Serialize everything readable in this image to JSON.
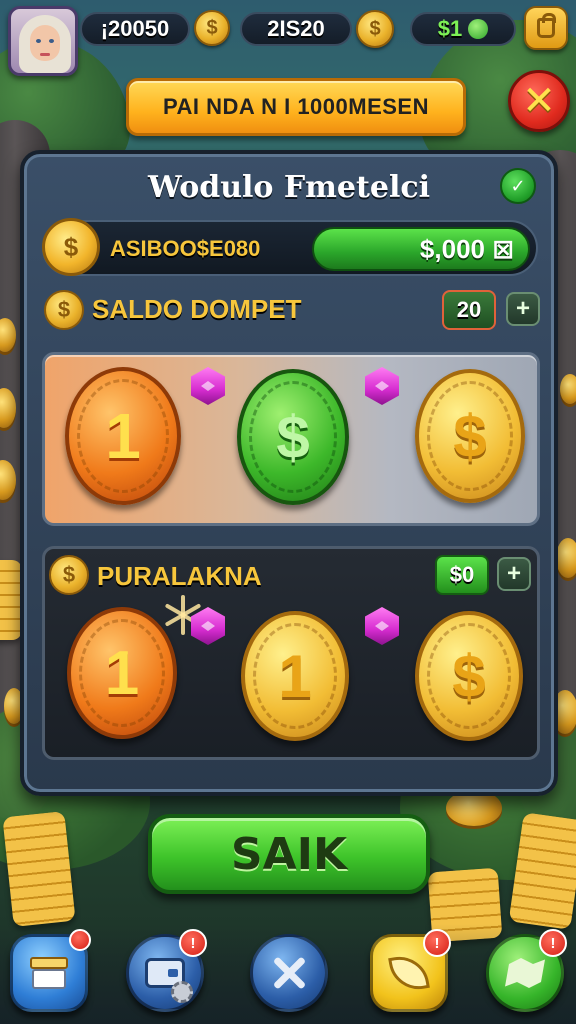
{
  "hud": {
    "stat1": "¡20050",
    "stat2": "2IS20",
    "stat3": "$1",
    "coin_symbol": "$",
    "shop_icon": "shopping-bag-icon"
  },
  "banner": {
    "text": "PAI NDA N I 1000MESEN"
  },
  "close_symbol": "✕",
  "panel": {
    "title": "Wodulo Fmetelci",
    "info_symbol": "✓",
    "balance": {
      "coin_symbol": "$",
      "label": "ASIBOO$E080",
      "value": "$,000 ⊠"
    },
    "saldo": {
      "coin_symbol": "$",
      "title": "SALDO DOMPET",
      "count": "20",
      "plus": "+",
      "coins": [
        {
          "color": "orange",
          "symbol": "1"
        },
        {
          "color": "green",
          "symbol": "$"
        },
        {
          "color": "gold",
          "symbol": "$"
        }
      ]
    },
    "pura": {
      "coin_symbol": "$",
      "title": "PURALAKNA",
      "count": "$0",
      "plus": "+",
      "coins": [
        {
          "color": "orange",
          "symbol": "1"
        },
        {
          "color": "gold",
          "symbol": "1"
        },
        {
          "color": "gold",
          "symbol": "$"
        }
      ]
    }
  },
  "action_button": "SAIK",
  "nav": {
    "items": [
      {
        "icon": "gift-box-icon",
        "badge": ""
      },
      {
        "icon": "wallet-icon",
        "badge": "!"
      },
      {
        "icon": "tools-icon",
        "badge": ""
      },
      {
        "icon": "leaf-icon",
        "badge": "!"
      },
      {
        "icon": "map-icon",
        "badge": "!"
      }
    ]
  },
  "colors": {
    "accent_gold": "#f7c63c",
    "accent_green": "#3ec42a",
    "close_red": "#e02a1e",
    "panel": "#2a394c"
  }
}
